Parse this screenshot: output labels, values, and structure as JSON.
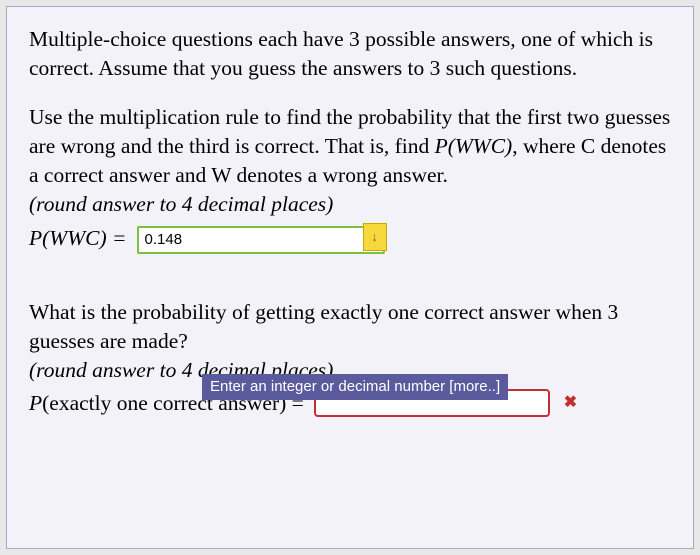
{
  "q1": {
    "intro": "Multiple-choice questions each have 3 possible answers, one of which is correct. Assume that you guess the answers to 3 such questions.",
    "prompt_a": "Use the multiplication rule to find the probability that the first two guesses are wrong and the third is correct. That is, find ",
    "pnotation": "P(WWC)",
    "prompt_b": ", where C denotes a correct answer and W denotes a wrong answer.",
    "hint": "(round answer to 4 decimal places)",
    "label": "P(WWC) = ",
    "input_value": "0.148",
    "arrow": "↓",
    "helper": "Enter an integer or decimal number [more..]"
  },
  "q2": {
    "prompt": "What is the probability of getting exactly one correct answer when 3 guesses are made?",
    "hint": "(round answer to 4 decimal places)",
    "label": "P(exactly one correct answer) = ",
    "input_value": "",
    "x": "✖"
  }
}
